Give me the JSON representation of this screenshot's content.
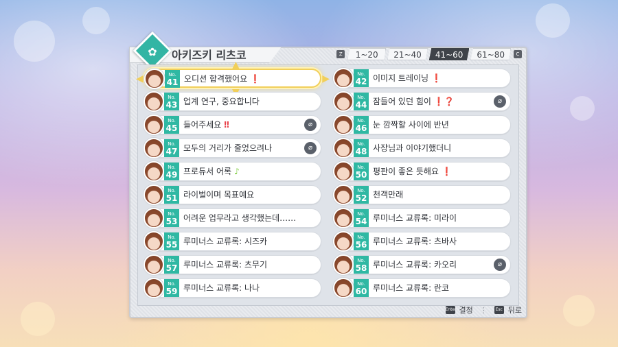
{
  "title": "아키즈키 리츠코",
  "tabs": {
    "prev_key": "Z",
    "next_key": "C",
    "items": [
      {
        "label": "1~20",
        "active": false
      },
      {
        "label": "21~40",
        "active": false
      },
      {
        "label": "41~60",
        "active": true
      },
      {
        "label": "61~80",
        "active": false
      }
    ]
  },
  "no_prefix": "No.",
  "episodes": [
    {
      "num": "41",
      "title": "오디션 합격했어요",
      "mark": "❗",
      "mark_type": "excl",
      "clip": false,
      "selected": true
    },
    {
      "num": "42",
      "title": "이미지 트레이닝",
      "mark": "❗",
      "mark_type": "excl",
      "clip": false,
      "selected": false
    },
    {
      "num": "43",
      "title": "업계 연구, 중요합니다",
      "mark": "",
      "mark_type": "",
      "clip": false,
      "selected": false
    },
    {
      "num": "44",
      "title": "잠들어 있던 힘이",
      "mark": "❗❓",
      "mark_type": "excl",
      "clip": true,
      "selected": false
    },
    {
      "num": "45",
      "title": "들어주세요",
      "mark": "‼",
      "mark_type": "excl",
      "clip": true,
      "selected": false
    },
    {
      "num": "46",
      "title": "눈 깜짝할 사이에 반년",
      "mark": "",
      "mark_type": "",
      "clip": false,
      "selected": false
    },
    {
      "num": "47",
      "title": "모두의 거리가 줄었으려나",
      "mark": "",
      "mark_type": "",
      "clip": true,
      "selected": false
    },
    {
      "num": "48",
      "title": "사장님과 이야기했더니",
      "mark": "",
      "mark_type": "",
      "clip": false,
      "selected": false
    },
    {
      "num": "49",
      "title": "프로듀서 어록",
      "mark": "♪",
      "mark_type": "note",
      "clip": false,
      "selected": false
    },
    {
      "num": "50",
      "title": "평판이 좋은 듯해요",
      "mark": "❗",
      "mark_type": "excl",
      "clip": false,
      "selected": false
    },
    {
      "num": "51",
      "title": "라이벌이며 목표예요",
      "mark": "",
      "mark_type": "",
      "clip": false,
      "selected": false
    },
    {
      "num": "52",
      "title": "천객만래",
      "mark": "",
      "mark_type": "",
      "clip": false,
      "selected": false
    },
    {
      "num": "53",
      "title": "어려운 업무라고 생각했는데……",
      "mark": "",
      "mark_type": "",
      "clip": false,
      "selected": false
    },
    {
      "num": "54",
      "title": "루미너스 교류록: 미라이",
      "mark": "",
      "mark_type": "",
      "clip": false,
      "selected": false
    },
    {
      "num": "55",
      "title": "루미너스 교류록: 시즈카",
      "mark": "",
      "mark_type": "",
      "clip": false,
      "selected": false
    },
    {
      "num": "56",
      "title": "루미너스 교류록: 츠바사",
      "mark": "",
      "mark_type": "",
      "clip": false,
      "selected": false
    },
    {
      "num": "57",
      "title": "루미너스 교류록: 츠무기",
      "mark": "",
      "mark_type": "",
      "clip": false,
      "selected": false
    },
    {
      "num": "58",
      "title": "루미너스 교류록: 카오리",
      "mark": "",
      "mark_type": "",
      "clip": true,
      "selected": false
    },
    {
      "num": "59",
      "title": "루미너스 교류록: 나나",
      "mark": "",
      "mark_type": "",
      "clip": false,
      "selected": false
    },
    {
      "num": "60",
      "title": "루미너스 교류록: 란코",
      "mark": "",
      "mark_type": "",
      "clip": false,
      "selected": false
    }
  ],
  "footer": {
    "confirm_key": "Enter",
    "confirm_label": "결정",
    "back_key": "Esc",
    "back_label": "뒤로"
  },
  "colors": {
    "accent": "#2fb8a3",
    "selection": "#f1cf5a",
    "active_tab": "#3f4349"
  }
}
